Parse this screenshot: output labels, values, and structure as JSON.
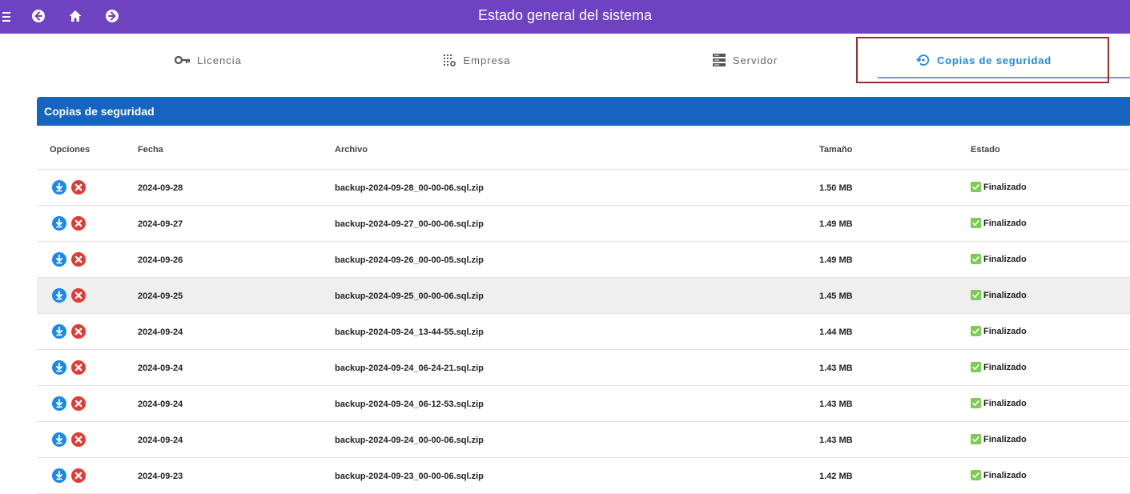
{
  "header": {
    "title": "Estado general del sistema",
    "icons": [
      "menu-icon",
      "back-icon",
      "home-icon",
      "forward-icon"
    ],
    "color": "#6f42c1"
  },
  "tabs": [
    {
      "label": "Licencia",
      "icon": "key-icon",
      "active": false
    },
    {
      "label": "Empresa",
      "icon": "building-icon",
      "active": false
    },
    {
      "label": "Servidor",
      "icon": "server-icon",
      "active": false
    },
    {
      "label": "Copias de seguridad",
      "icon": "backup-restore-icon",
      "active": true
    }
  ],
  "panel": {
    "title": "Copias de seguridad",
    "color": "#1565c0"
  },
  "table": {
    "columns": [
      "Opciones",
      "Fecha",
      "Archivo",
      "Tamaño",
      "Estado"
    ],
    "rows": [
      {
        "fecha": "2024-09-28",
        "archivo": "backup-2024-09-28_00-00-06.sql.zip",
        "tamano": "1.50 MB",
        "estado": "Finalizado"
      },
      {
        "fecha": "2024-09-27",
        "archivo": "backup-2024-09-27_00-00-06.sql.zip",
        "tamano": "1.49 MB",
        "estado": "Finalizado"
      },
      {
        "fecha": "2024-09-26",
        "archivo": "backup-2024-09-26_00-00-05.sql.zip",
        "tamano": "1.49 MB",
        "estado": "Finalizado"
      },
      {
        "fecha": "2024-09-25",
        "archivo": "backup-2024-09-25_00-00-06.sql.zip",
        "tamano": "1.45 MB",
        "estado": "Finalizado"
      },
      {
        "fecha": "2024-09-24",
        "archivo": "backup-2024-09-24_13-44-55.sql.zip",
        "tamano": "1.44 MB",
        "estado": "Finalizado"
      },
      {
        "fecha": "2024-09-24",
        "archivo": "backup-2024-09-24_06-24-21.sql.zip",
        "tamano": "1.43 MB",
        "estado": "Finalizado"
      },
      {
        "fecha": "2024-09-24",
        "archivo": "backup-2024-09-24_06-12-53.sql.zip",
        "tamano": "1.43 MB",
        "estado": "Finalizado"
      },
      {
        "fecha": "2024-09-24",
        "archivo": "backup-2024-09-24_00-00-06.sql.zip",
        "tamano": "1.43 MB",
        "estado": "Finalizado"
      },
      {
        "fecha": "2024-09-23",
        "archivo": "backup-2024-09-23_00-00-06.sql.zip",
        "tamano": "1.42 MB",
        "estado": "Finalizado"
      }
    ]
  }
}
